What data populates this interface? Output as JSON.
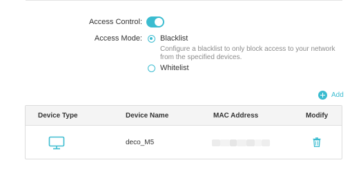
{
  "access_control": {
    "label": "Access Control:",
    "enabled": true
  },
  "access_mode": {
    "label": "Access Mode:",
    "options": [
      {
        "label": "Blacklist",
        "selected": true,
        "description": "Configure a blacklist to only block access to your network from the specified devices."
      },
      {
        "label": "Whitelist",
        "selected": false
      }
    ]
  },
  "add_button": {
    "label": "Add",
    "icon": "plus-circle-icon"
  },
  "table": {
    "columns": [
      "Device Type",
      "Device Name",
      "MAC Address",
      "Modify"
    ],
    "rows": [
      {
        "device_type_icon": "monitor-icon",
        "device_name": "deco_M5",
        "mac_address_visible": false,
        "modify_icon": "trash-icon"
      }
    ]
  },
  "colors": {
    "accent": "#3bbcd0",
    "text": "#333333",
    "muted_text": "#8c8c8c",
    "table_header_bg": "#f4f4f4",
    "border": "#dcdcdc"
  }
}
